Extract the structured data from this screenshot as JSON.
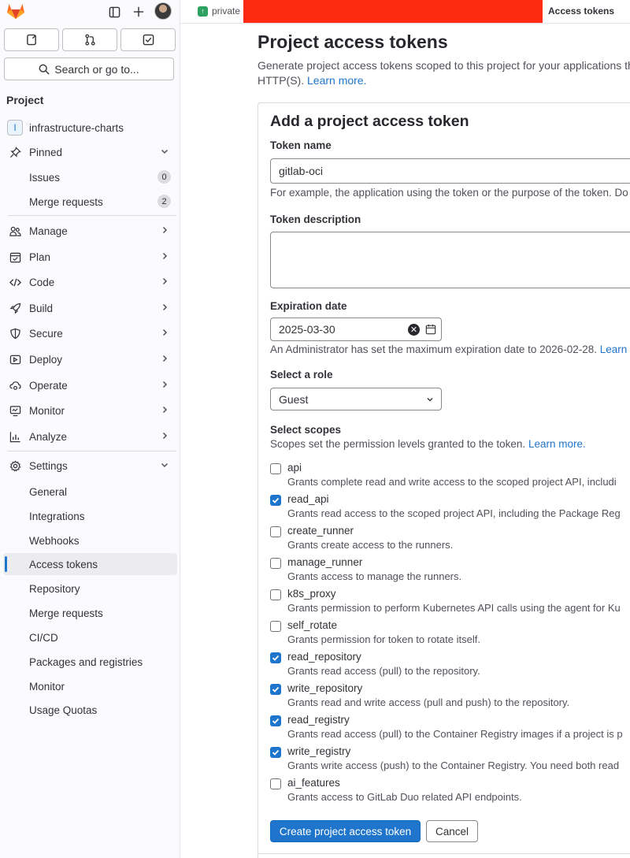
{
  "breadcrumb": {
    "private_label": "private",
    "current": "Access tokens"
  },
  "sidebar": {
    "search_label": "Search or go to...",
    "section_title": "Project",
    "project_initial": "I",
    "project_name": "infrastructure-charts",
    "pinned": "Pinned",
    "pinned_items": [
      {
        "label": "Issues",
        "count": "0"
      },
      {
        "label": "Merge requests",
        "count": "2"
      }
    ],
    "menu": [
      {
        "label": "Manage"
      },
      {
        "label": "Plan"
      },
      {
        "label": "Code"
      },
      {
        "label": "Build"
      },
      {
        "label": "Secure"
      },
      {
        "label": "Deploy"
      },
      {
        "label": "Operate"
      },
      {
        "label": "Monitor"
      },
      {
        "label": "Analyze"
      }
    ],
    "settings": "Settings",
    "settings_items": [
      {
        "label": "General"
      },
      {
        "label": "Integrations"
      },
      {
        "label": "Webhooks"
      },
      {
        "label": "Access tokens"
      },
      {
        "label": "Repository"
      },
      {
        "label": "Merge requests"
      },
      {
        "label": "CI/CD"
      },
      {
        "label": "Packages and registries"
      },
      {
        "label": "Monitor"
      },
      {
        "label": "Usage Quotas"
      }
    ]
  },
  "page": {
    "title": "Project access tokens",
    "desc_line1": "Generate project access tokens scoped to this project for your applications tha",
    "desc_line2": "HTTP(S).",
    "learn_more": "Learn more."
  },
  "form": {
    "title": "Add a project access token",
    "token_name_label": "Token name",
    "token_name_value": "gitlab-oci",
    "token_name_help": "For example, the application using the token or the purpose of the token. Do",
    "description_label": "Token description",
    "expiration_label": "Expiration date",
    "expiration_value": "2025-03-30",
    "expiration_help": "An Administrator has set the maximum expiration date to 2026-02-28.",
    "expiration_help_link": "Learn",
    "role_label": "Select a role",
    "role_value": "Guest",
    "scopes_label": "Select scopes",
    "scopes_help": "Scopes set the permission levels granted to the token.",
    "scopes_help_link": "Learn more.",
    "scopes": [
      {
        "name": "api",
        "desc": "Grants complete read and write access to the scoped project API, includi",
        "checked": false
      },
      {
        "name": "read_api",
        "desc": "Grants read access to the scoped project API, including the Package Reg",
        "checked": true
      },
      {
        "name": "create_runner",
        "desc": "Grants create access to the runners.",
        "checked": false
      },
      {
        "name": "manage_runner",
        "desc": "Grants access to manage the runners.",
        "checked": false
      },
      {
        "name": "k8s_proxy",
        "desc": "Grants permission to perform Kubernetes API calls using the agent for Ku",
        "checked": false
      },
      {
        "name": "self_rotate",
        "desc": "Grants permission for token to rotate itself.",
        "checked": false
      },
      {
        "name": "read_repository",
        "desc": "Grants read access (pull) to the repository.",
        "checked": true
      },
      {
        "name": "write_repository",
        "desc": "Grants read and write access (pull and push) to the repository.",
        "checked": true
      },
      {
        "name": "read_registry",
        "desc": "Grants read access (pull) to the Container Registry images if a project is p",
        "checked": true
      },
      {
        "name": "write_registry",
        "desc": "Grants write access (push) to the Container Registry. You need both read",
        "checked": true
      },
      {
        "name": "ai_features",
        "desc": "Grants access to GitLab Duo related API endpoints.",
        "checked": false
      }
    ],
    "submit_label": "Create project access token",
    "cancel_label": "Cancel"
  },
  "colors": {
    "accent": "#1f75cb",
    "redaction": "#ff2a12",
    "logo": "#fc6d26"
  }
}
